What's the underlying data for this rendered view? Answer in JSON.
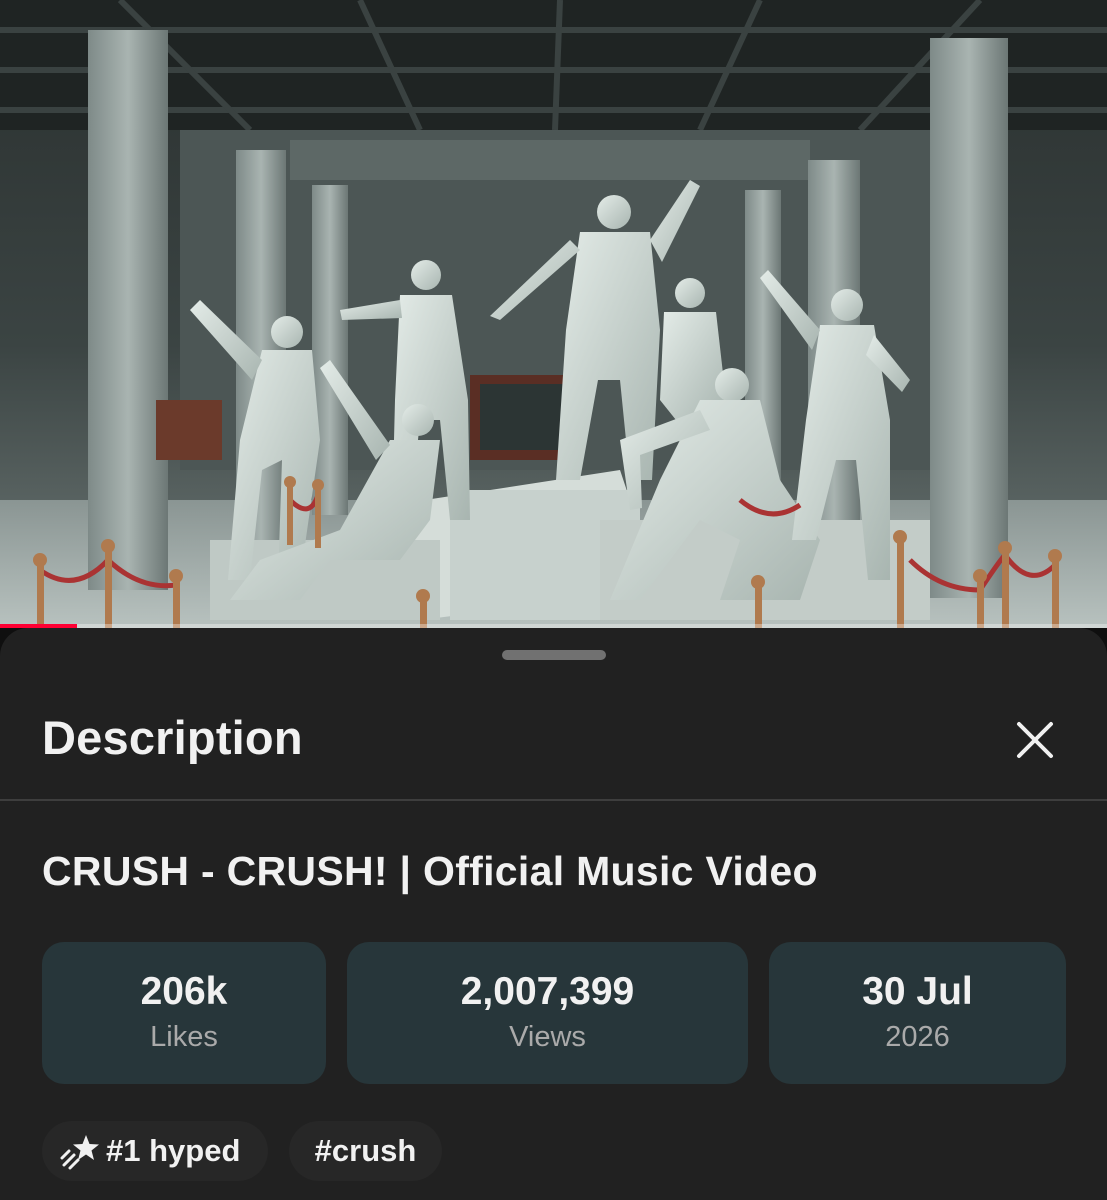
{
  "player": {
    "progress_fraction": 0.07,
    "progress_color": "#ff0033"
  },
  "sheet": {
    "title": "Description",
    "close_icon": "close-icon"
  },
  "video": {
    "title": "CRUSH - CRUSH! | Official Music Video"
  },
  "stats": [
    {
      "value": "206k",
      "label": "Likes"
    },
    {
      "value": "2,007,399",
      "label": "Views"
    },
    {
      "value": "30 Jul",
      "label": "2026"
    }
  ],
  "chips": [
    {
      "icon": "hype-star-icon",
      "label": "#1 hyped"
    },
    {
      "label": "#crush"
    }
  ],
  "colors": {
    "sheet_background": "#212121",
    "stat_card": "#27363a",
    "chip": "#272727"
  }
}
